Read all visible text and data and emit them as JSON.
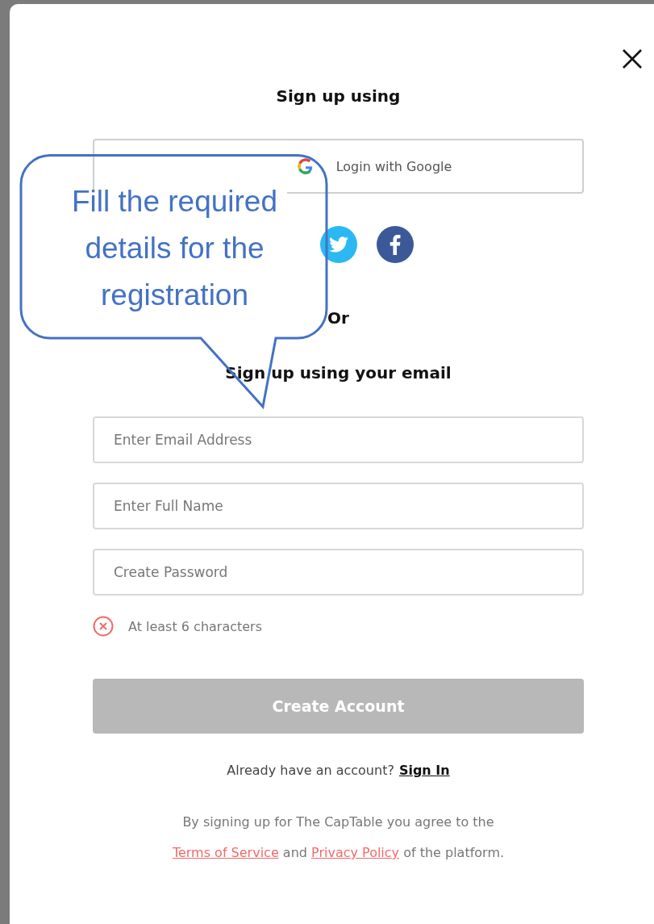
{
  "dialog": {
    "title": "Sign up using",
    "google_button": "Login with Google",
    "social": [
      {
        "kind": "twitter"
      },
      {
        "kind": "facebook"
      }
    ],
    "separator": "Or",
    "email_heading": "Sign up using your email",
    "fields": [
      {
        "placeholder": "Enter Email Address"
      },
      {
        "placeholder": "Enter Full Name"
      },
      {
        "placeholder": "Create Password"
      }
    ],
    "validation": {
      "text": "At least 6 characters",
      "valid": false
    },
    "submit": {
      "label": "Create Account",
      "disabled": true
    },
    "signin": {
      "prompt": "Already have an account?",
      "link": "Sign In"
    },
    "legal": {
      "before": "By signing up for The CapTable you agree to the",
      "terms": "Terms of Service",
      "and": "and",
      "privacy": "Privacy Policy",
      "after": "of the platform."
    }
  },
  "callout": {
    "text": "Fill the required details for the registration"
  }
}
